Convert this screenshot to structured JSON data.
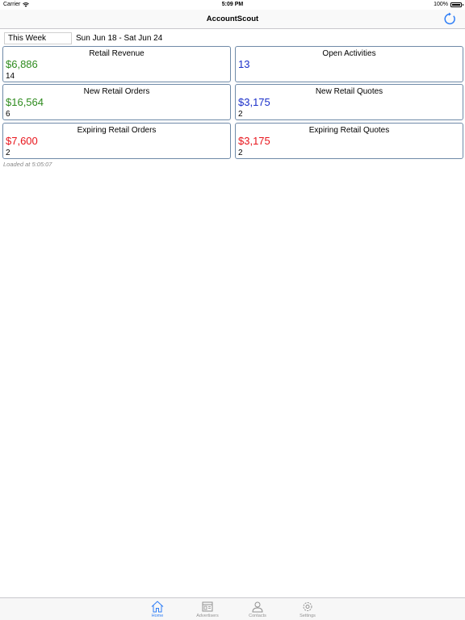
{
  "status_bar": {
    "carrier": "Carrier",
    "time": "5:09 PM",
    "battery": "100%"
  },
  "nav": {
    "title": "AccountScout",
    "refresh_icon": "refresh-icon"
  },
  "filter": {
    "period": "This Week",
    "range": "Sun Jun 18 - Sat Jun 24"
  },
  "cards": [
    {
      "title": "Retail Revenue",
      "value": "$6,886",
      "count": "14",
      "color": "#2e8b1e"
    },
    {
      "title": "Open Activities",
      "value": "13",
      "count": "",
      "color": "#1a2fc9"
    },
    {
      "title": "New Retail Orders",
      "value": "$16,564",
      "count": "6",
      "color": "#2e8b1e"
    },
    {
      "title": "New Retail Quotes",
      "value": "$3,175",
      "count": "2",
      "color": "#1a2fc9"
    },
    {
      "title": "Expiring Retail Orders",
      "value": "$7,600",
      "count": "2",
      "color": "#e8141b"
    },
    {
      "title": "Expiring Retail Quotes",
      "value": "$3,175",
      "count": "2",
      "color": "#e8141b"
    }
  ],
  "loaded_text": "Loaded at 5:05:07",
  "tabs": [
    {
      "label": "Home",
      "icon": "home-icon",
      "active": true
    },
    {
      "label": "Advertisers",
      "icon": "advertisers-icon",
      "active": false
    },
    {
      "label": "Contacts",
      "icon": "contacts-icon",
      "active": false
    },
    {
      "label": "Settings",
      "icon": "gear-icon",
      "active": false
    }
  ],
  "colors": {
    "accent": "#2f7ef6",
    "card_border": "#6f8aa8",
    "inactive_tab": "#929292"
  }
}
